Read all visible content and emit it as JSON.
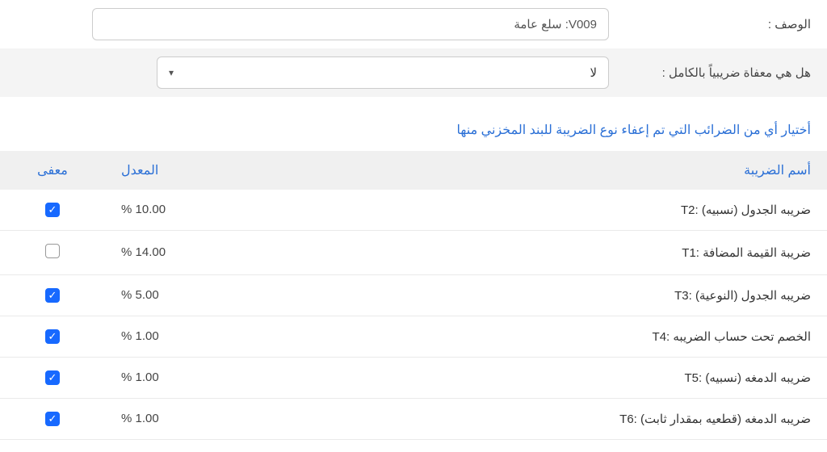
{
  "form": {
    "description_label": "الوصف :",
    "description_value": "V009: سلع عامة",
    "fully_exempt_label": "هل هي معفاة ضريبياً بالكامل :",
    "fully_exempt_value": "لا"
  },
  "section_title": "أختيار أي من الضرائب التي تم إعفاء نوع الضريبة للبند المخزني منها",
  "columns": {
    "name": "أسم الضريبة",
    "rate": "المعدل",
    "exempt": "معفى"
  },
  "taxes": [
    {
      "name": "T2: ضريبه الجدول (نسبيه)",
      "rate": "% 10.00",
      "exempt": true
    },
    {
      "name": "T1: ضريبة القيمة المضافة",
      "rate": "% 14.00",
      "exempt": false
    },
    {
      "name": "T3: ضريبه الجدول (النوعية)",
      "rate": "% 5.00",
      "exempt": true
    },
    {
      "name": "T4: الخصم تحت حساب الضريبه",
      "rate": "% 1.00",
      "exempt": true
    },
    {
      "name": "T5: ضريبه الدمغه (نسبيه)",
      "rate": "% 1.00",
      "exempt": true
    },
    {
      "name": "T6: ضريبه الدمغه (قطعيه بمقدار ثابت)",
      "rate": "% 1.00",
      "exempt": true
    }
  ]
}
